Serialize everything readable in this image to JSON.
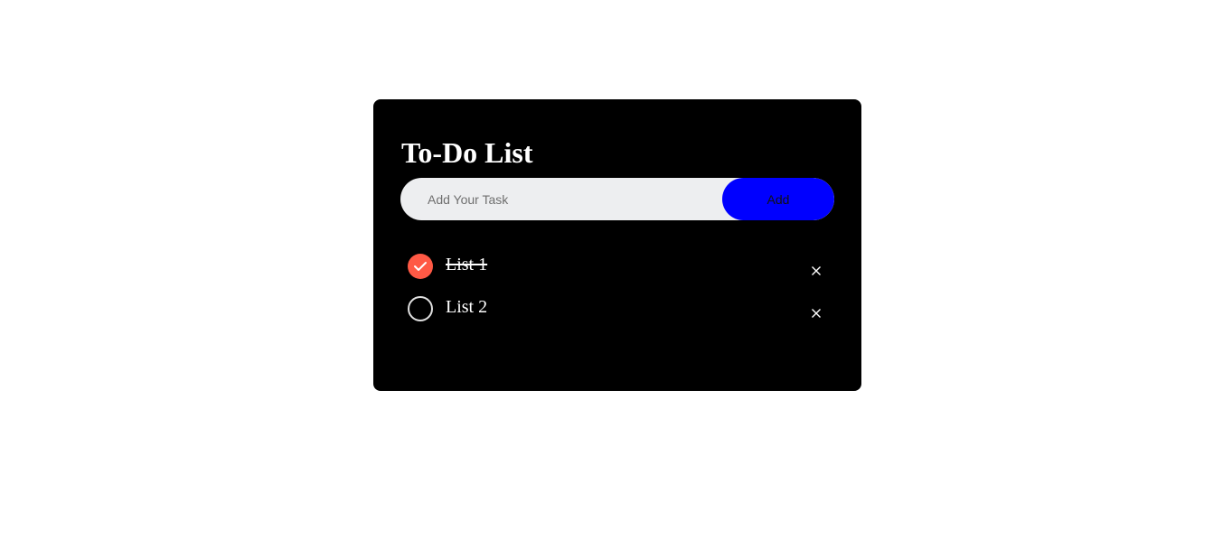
{
  "app": {
    "title": "To-Do List"
  },
  "input": {
    "placeholder": "Add Your Task",
    "value": ""
  },
  "add_button": {
    "label": "Add"
  },
  "tasks": [
    {
      "label": "List 1",
      "checked": true,
      "icon": "check-icon",
      "delete_icon": "close-icon"
    },
    {
      "label": "List 2",
      "checked": false,
      "icon": "empty-circle-icon",
      "delete_icon": "close-icon"
    }
  ],
  "colors": {
    "card_background": "#000000",
    "accent": "#0000ff",
    "checked": "#ff5945",
    "input_background": "#edeef0"
  }
}
